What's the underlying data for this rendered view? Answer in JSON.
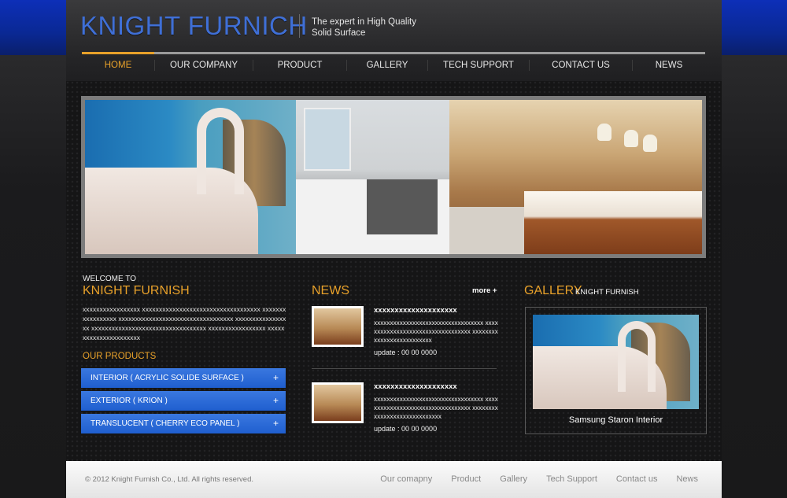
{
  "header": {
    "logo": "KNIGHT FURNICH",
    "tagline_line1": "The expert in High Quality",
    "tagline_line2": "Solid Surface",
    "nav": [
      {
        "label": "HOME",
        "active": true
      },
      {
        "label": "OUR COMPANY"
      },
      {
        "label": "PRODUCT"
      },
      {
        "label": "GALLERY"
      },
      {
        "label": "TECH SUPPORT"
      },
      {
        "label": "CONTACT US"
      },
      {
        "label": "NEWS"
      }
    ]
  },
  "welcome": {
    "small": "WELCOME TO",
    "title": "KNIGHT FURNISH",
    "text": "xxxxxxxxxxxxxxxxx xxxxxxxxxxxxxxxxxxxxxxxxxxxxxxxxxxx xxxxxxxxxxxxxxxxx xxxxxxxxxxxxxxxxxxxxxxxxxxxxxxxxxx xxxxxxxxxxxxxxxxx xxxxxxxxxxxxxxxxxxxxxxxxxxxxxxxxxx xxxxxxxxxxxxxxxxx xxxxxxxxxxxxxxxxxxxxxx"
  },
  "products": {
    "title": "OUR PRODUCTS",
    "items": [
      {
        "label": "INTERIOR  ( ACRYLIC SOLIDE SURFACE )",
        "icon": "+"
      },
      {
        "label": "EXTERIOR  ( KRION )",
        "icon": "+"
      },
      {
        "label": "TRANSLUCENT  ( CHERRY ECO PANEL )",
        "icon": "+"
      }
    ]
  },
  "news": {
    "title": "NEWS",
    "more": "more +",
    "items": [
      {
        "headline": "xxxxxxxxxxxxxxxxxxxx",
        "body": "xxxxxxxxxxxxxxxxxxxxxxxxxxxxxxxxxx xxxxxxxxxxxxxxxxxxxxxxxxxxxxxxxxxx xxxxxxxxxxxxxxxxxxxxxxxxxx",
        "date": "update : 00 00 0000"
      },
      {
        "headline": "xxxxxxxxxxxxxxxxxxxx",
        "body": "xxxxxxxxxxxxxxxxxxxxxxxxxxxxxxxxxx xxxxxxxxxxxxxxxxxxxxxxxxxxxxxxxxxx xxxxxxxxxxxxxxxxxxxxxxxxxxxxx",
        "date": "update : 00 00 0000"
      }
    ]
  },
  "gallery": {
    "title": "GALLERY",
    "subtitle": "KNIGHT FURNISH",
    "caption": "Samsung Staron Interior"
  },
  "footer": {
    "copyright": "© 2012 Knight Furnish Co., Ltd. All rights reserved.",
    "links": [
      "Our comapny",
      "Product",
      "Gallery",
      "Tech Support",
      "Contact us",
      "News"
    ]
  },
  "colors": {
    "accent": "#e8a12a",
    "logo_blue": "#3f6fd6",
    "button_blue": "#2a6bd8"
  }
}
